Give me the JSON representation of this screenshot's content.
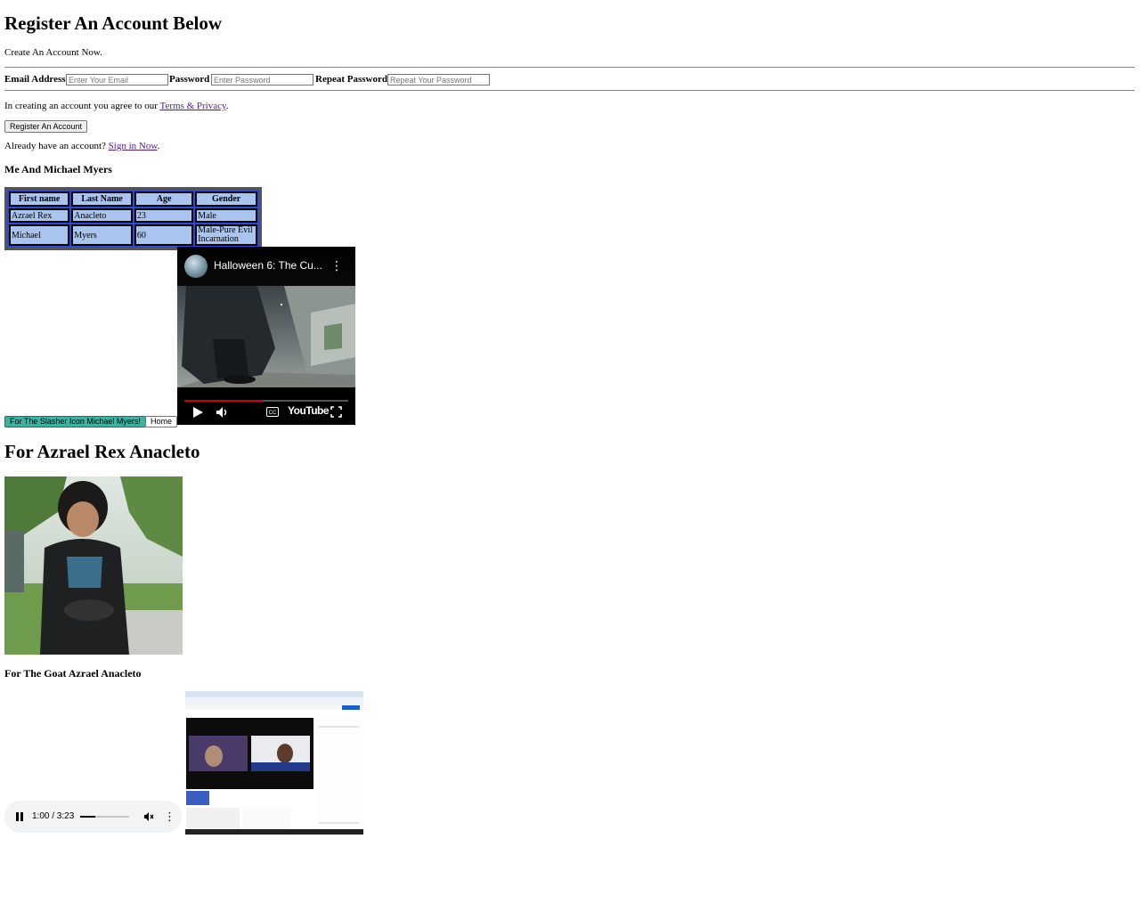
{
  "register": {
    "heading": "Register An Account Below",
    "subtitle": "Create An Account Now.",
    "email_label": "Email Address",
    "email_placeholder": "Enter Your Email",
    "password_label": "Password",
    "password_placeholder": "Enter Password",
    "repeat_label": "Repeat Password",
    "repeat_placeholder": "Repeat Your Password",
    "terms_prefix": "In creating an account you agree to our ",
    "terms_link": "Terms & Privacy",
    "terms_suffix": ".",
    "submit_label": "Register An Account",
    "signin_prefix": "Already have an account? ",
    "signin_link": "Sign in Now",
    "signin_suffix": "."
  },
  "table_section": {
    "heading": "Me And Michael Myers",
    "headers": [
      "First name",
      "Last Name",
      "Age",
      "Gender"
    ],
    "rows": [
      [
        "Azrael Rex",
        "Anacleto",
        "23",
        "Male"
      ],
      [
        "Michael",
        "Myers",
        "60",
        "Male-Pure Evil Incarnation"
      ]
    ]
  },
  "video": {
    "title": "Halloween 6: The Cu...",
    "brand": "YouTube",
    "progress": 0.48
  },
  "buttons": {
    "slasher_label": "For The Slasher Icon Michael Myers!",
    "home_label": "Home"
  },
  "azrael": {
    "heading": "For Azrael Rex Anacleto",
    "goat_heading": "For The Goat Azrael Anacleto"
  },
  "audio": {
    "time": "1:00 / 3:23",
    "progress": 0.31
  },
  "colors": {
    "slasher_button": "#3cb3a0",
    "table_border": "#2a4bd7",
    "table_cell": "#a9c4ee",
    "link": "#551a8b"
  }
}
